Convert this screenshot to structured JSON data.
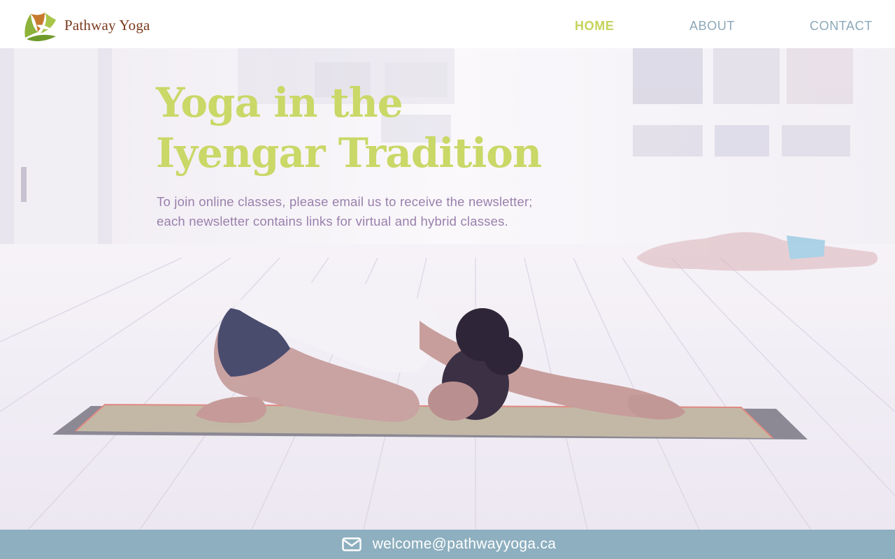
{
  "brand": {
    "name": "Pathway Yoga",
    "logo_icon": "lotus-leaf-logo",
    "colors": {
      "leaf_green": "#8db33a",
      "leaf_orange": "#c7792c",
      "text_brown": "#7a3b1e"
    }
  },
  "nav": {
    "items": [
      {
        "label": "HOME",
        "active": true
      },
      {
        "label": "ABOUT",
        "active": false
      },
      {
        "label": "CONTACT",
        "active": false
      }
    ],
    "active_color": "#c5d45c",
    "inactive_color": "#8ba8b8"
  },
  "hero": {
    "title_line1": "Yoga in the",
    "title_line2": "Iyengar Tradition",
    "text_line1": "To join online classes, please email us to receive the newsletter;",
    "text_line2": "each newsletter contains links for virtual and hybrid classes.",
    "title_color": "#c9d867",
    "text_color": "#9a80ad",
    "image_description_icon": "yoga-studio-photo"
  },
  "footer": {
    "icon": "envelope-icon",
    "email": "welcome@pathwayyoga.ca",
    "background": "#8dafbf"
  }
}
